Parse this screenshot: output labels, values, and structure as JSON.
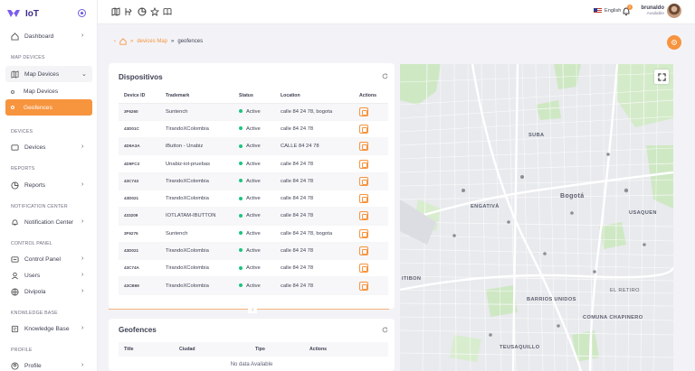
{
  "brand": {
    "name": "IoT"
  },
  "sidebar": {
    "dashboard": "Dashboard",
    "section_map": "MAP DEVICES",
    "map_devices": "Map Devices",
    "sub_map_devices": "Map Devices",
    "sub_geofences": "Geofences",
    "section_devices": "DEVICES",
    "devices": "Devices",
    "section_reports": "REPORTS",
    "reports": "Reports",
    "section_notification": "NOTIFICATION CENTER",
    "notification_center": "Notification Center",
    "section_control": "CONTROL PANEL",
    "control_panel": "Control Panel",
    "users": "Users",
    "divipola": "Divipola",
    "section_knowledge": "KNOWLEDGE BASE",
    "knowledge_base": "Knowledge Base",
    "section_profile": "PROFILE",
    "profile": "Profile"
  },
  "topbar": {
    "language": "English",
    "user_name": "brunaldo",
    "user_status": "Available",
    "notification_count": "1",
    "icons": [
      "map-icon",
      "route-icon",
      "chart-icon",
      "star-icon",
      "book-icon"
    ]
  },
  "breadcrumb": {
    "link": "devices Map",
    "current": "geofences"
  },
  "devices_card": {
    "title": "Dispositivos",
    "headers": [
      "Device ID",
      "Trademark",
      "Status",
      "Location",
      "Actions"
    ],
    "rows": [
      {
        "id": "3F6260",
        "trademark": "Suntench",
        "status": "Active",
        "location": "calle 84 24 78, bogota"
      },
      {
        "id": "43D01C",
        "trademark": "TirandoXColombia",
        "status": "Active",
        "location": "calle 84 24 78"
      },
      {
        "id": "4D9A3A",
        "trademark": "iButton - Unabiz",
        "status": "Active",
        "location": "CALLE 84 24 78"
      },
      {
        "id": "4D9FC3",
        "trademark": "Unabiz-iot-pruebas",
        "status": "Active",
        "location": "calle 84 24 78"
      },
      {
        "id": "43C743",
        "trademark": "TirandoXColombia",
        "status": "Active",
        "location": "calle 84 24 78"
      },
      {
        "id": "43D021",
        "trademark": "TirandoXColombia",
        "status": "Active",
        "location": "calle 84 24 78"
      },
      {
        "id": "433209",
        "trademark": "IOTLATAM-IBUTTON",
        "status": "Active",
        "location": "calle 84 24 78"
      },
      {
        "id": "3F6275",
        "trademark": "Suntench",
        "status": "Active",
        "location": "calle 84 24 78, bogota"
      },
      {
        "id": "43D021",
        "trademark": "TirandoXColombia",
        "status": "Active",
        "location": "calle 84 24 78"
      },
      {
        "id": "43C74A",
        "trademark": "TirandoXColombia",
        "status": "Active",
        "location": "calle 84 24 78"
      },
      {
        "id": "43CB69",
        "trademark": "TirandoXColombia",
        "status": "Active",
        "location": "calle 84 24 78"
      }
    ]
  },
  "geofences_card": {
    "title": "Geofences",
    "headers": [
      "Title",
      "Ciudad",
      "Tipo",
      "Actions"
    ],
    "empty": "No data Available"
  },
  "map": {
    "labels": [
      "SUBA",
      "Bogotá",
      "USAQUEN",
      "ENGATIVÁ",
      "BARRIOS UNIDOS",
      "COMUNA CHAPINERO",
      "TEUSAQUILLO",
      "ITIBON",
      "EL RETIRO"
    ]
  },
  "colors": {
    "accent": "#f7943e",
    "brand": "#3f2c8c",
    "status_active": "#1bc47d"
  }
}
